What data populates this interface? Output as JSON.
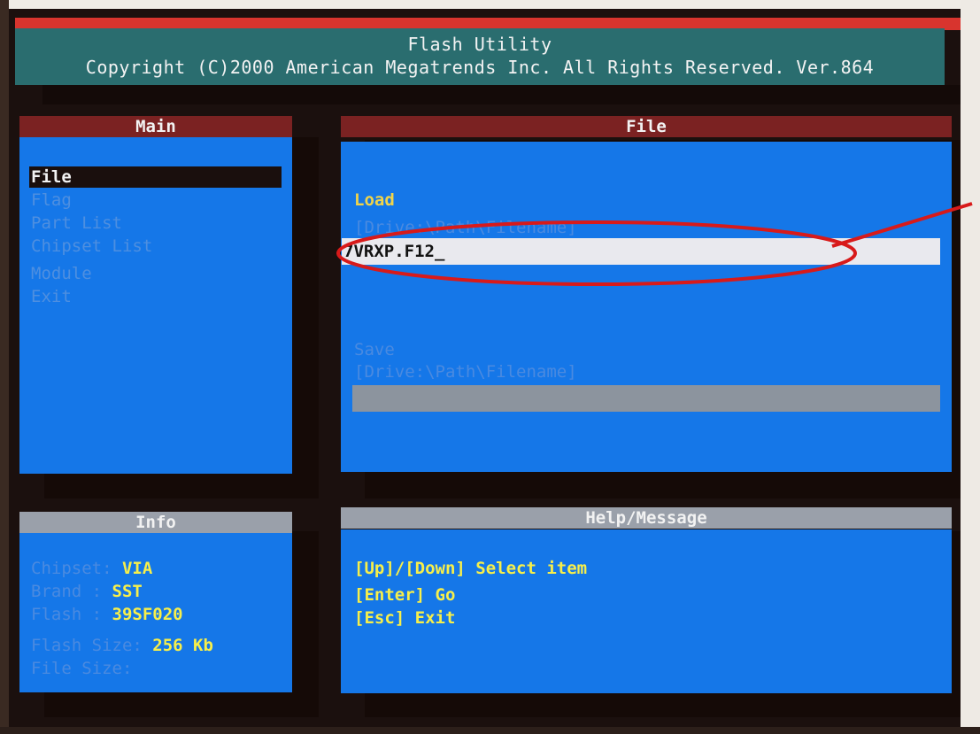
{
  "header": {
    "title": "Flash Utility",
    "copyright": "Copyright (C)2000 American Megatrends Inc. All Rights Reserved. Ver.864"
  },
  "main_panel": {
    "title": "Main",
    "items": [
      {
        "label": "File",
        "active": true
      },
      {
        "label": "Flag",
        "active": false
      },
      {
        "label": "Part List",
        "active": false
      },
      {
        "label": "Chipset List",
        "active": false
      },
      {
        "label": "Module",
        "active": false
      },
      {
        "label": "Exit",
        "active": false
      }
    ]
  },
  "file_panel": {
    "title": "File",
    "load_label": "Load",
    "load_hint": "[Drive:\\Path\\Filename]",
    "load_value": "7VRXP.F12_",
    "save_label": "Save",
    "save_hint": "[Drive:\\Path\\Filename]",
    "save_value": ""
  },
  "info_panel": {
    "title": "Info",
    "rows": [
      {
        "label": "Chipset: ",
        "value": "VIA"
      },
      {
        "label": "Brand   : ",
        "value": "SST"
      },
      {
        "label": "Flash   : ",
        "value": "39SF020"
      },
      {
        "label": "Flash Size: ",
        "value": "256 Kb"
      },
      {
        "label": "File  Size: ",
        "value": ""
      }
    ]
  },
  "help_panel": {
    "title": "Help/Message",
    "lines": [
      "[Up]/[Down] Select item",
      "[Enter] Go",
      "[Esc] Exit"
    ]
  },
  "colors": {
    "header_bg": "#2a6d6f",
    "panel_bg": "#1577e8",
    "title_red": "#7b2222",
    "title_grey": "#9aa0aa",
    "highlight_text": "#f7ef4a",
    "annotation": "#d81a1a"
  }
}
